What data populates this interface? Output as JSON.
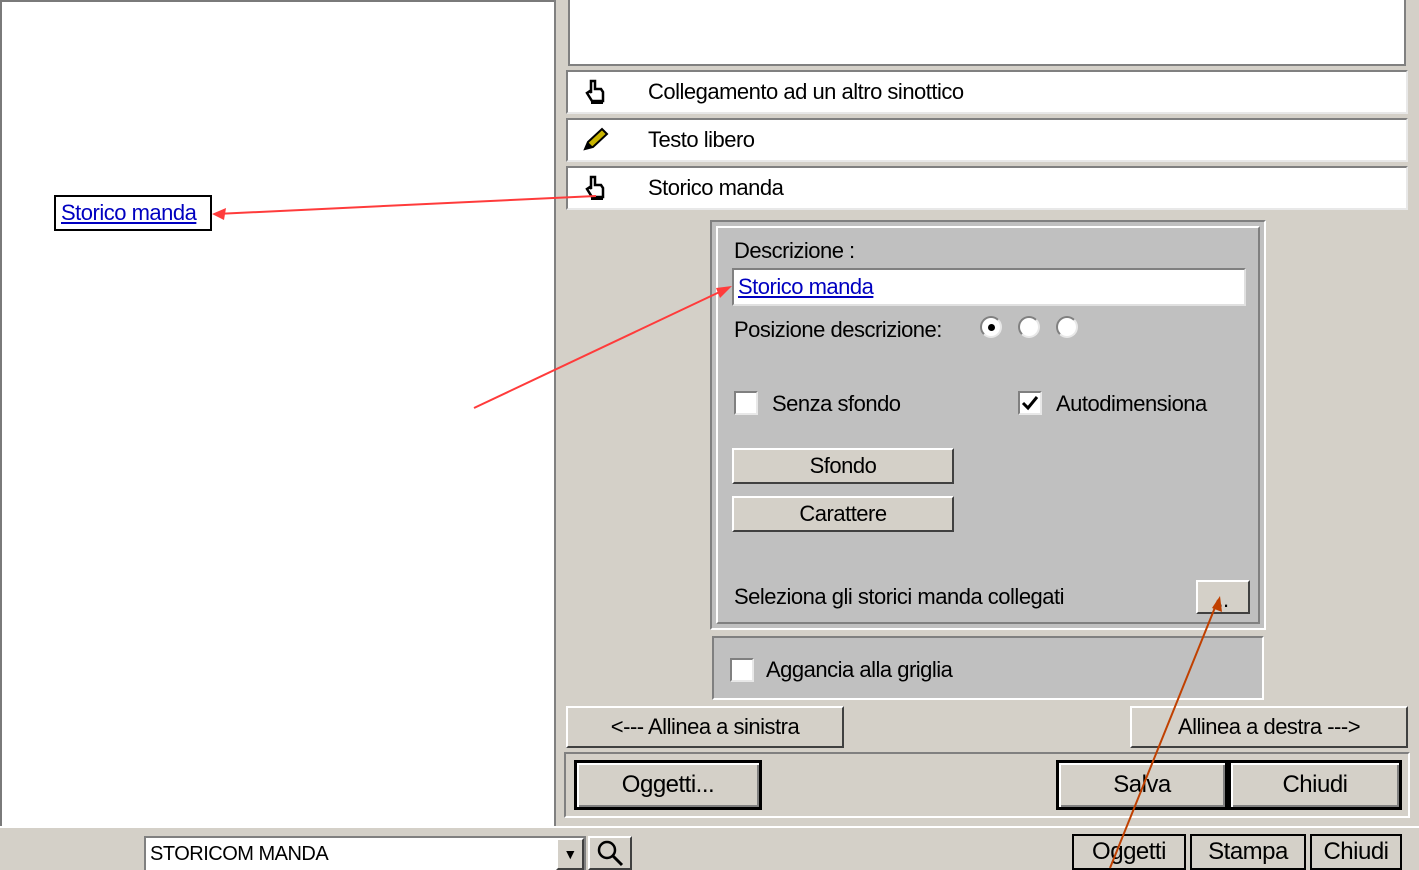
{
  "canvas": {
    "object_label": "Storico manda"
  },
  "object_list": {
    "items": [
      {
        "label": "Collegamento ad un altro sinottico",
        "icon": "hand-pointer-icon"
      },
      {
        "label": "Testo libero",
        "icon": "pencil-icon"
      },
      {
        "label": "Storico manda",
        "icon": "hand-pointer-icon"
      }
    ]
  },
  "properties": {
    "description_label": "Descrizione :",
    "description_value": "Storico manda",
    "position_label": "Posizione descrizione:",
    "position_options_selected": 0,
    "no_background_label": "Senza sfondo",
    "no_background_checked": false,
    "autosize_label": "Autodimensiona",
    "autosize_checked": true,
    "background_button": "Sfondo",
    "font_button": "Carattere",
    "linked_label": "Seleziona gli storici manda collegati",
    "linked_button": "..",
    "snap_grid_label": "Aggancia alla griglia",
    "snap_grid_checked": false
  },
  "align": {
    "left": "<---  Allinea a sinistra",
    "right": "Allinea a destra  --->"
  },
  "actions": {
    "objects": "Oggetti...",
    "save": "Salva",
    "close": "Chiudi"
  },
  "bottom": {
    "combo_value": "STORICOM MANDA",
    "objects": "Oggetti",
    "print": "Stampa",
    "close": "Chiudi"
  },
  "colors": {
    "panel": "#d4d0c8",
    "group": "#c0c0c0",
    "link": "#0000c0",
    "arrow_red": "#ff3b3b",
    "arrow_brown": "#c04000"
  }
}
